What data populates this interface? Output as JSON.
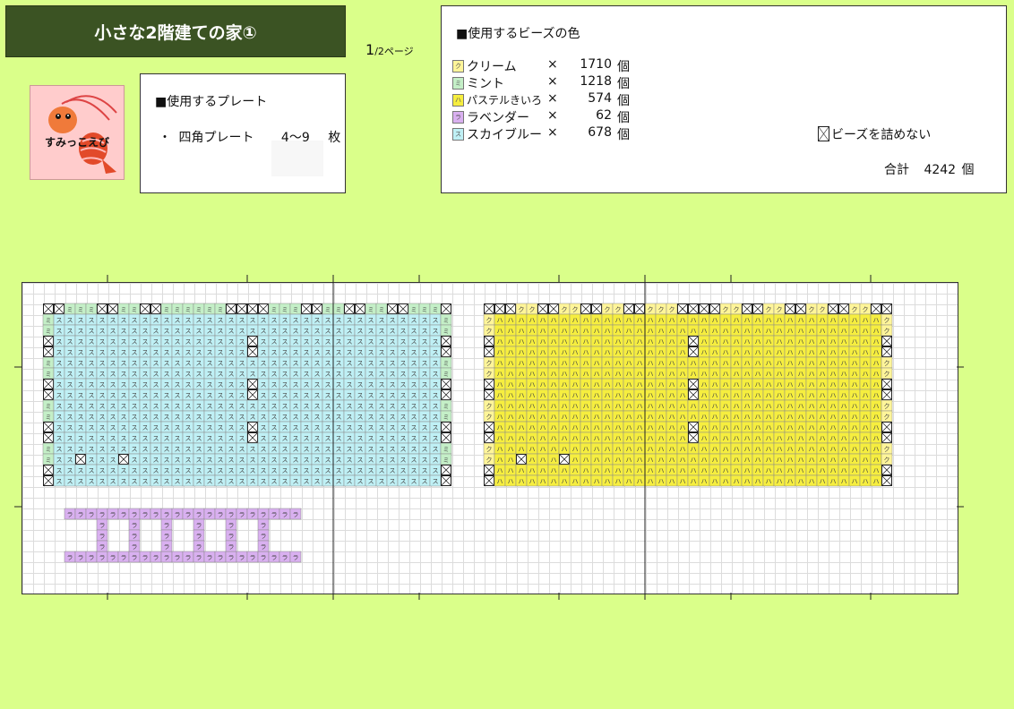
{
  "header": {
    "title": "小さな2階建ての家①",
    "page_current": "1",
    "page_suffix": "/2ページ"
  },
  "logo": {
    "text": "すみっこえび",
    "icon": "shrimp-icon"
  },
  "plate": {
    "heading": "■使用するプレート",
    "bullet": "・",
    "name": "四角プレート",
    "range": "4～9",
    "unit": "枚"
  },
  "beads": {
    "heading": "■使用するビーズの色",
    "items": [
      {
        "symbol": "ク",
        "name": "クリーム",
        "x": "×",
        "count": "1710",
        "unit": "個",
        "color": "#fff599"
      },
      {
        "symbol": "ミ",
        "name": "ミント",
        "x": "×",
        "count": "1218",
        "unit": "個",
        "color": "#c4efc7"
      },
      {
        "symbol": "ハ",
        "name": "パステルきいろ",
        "x": "×",
        "count": "574",
        "unit": "個",
        "color": "#f6ee3f"
      },
      {
        "symbol": "ラ",
        "name": "ラベンダー",
        "x": "×",
        "count": "62",
        "unit": "個",
        "color": "#d9b0f0"
      },
      {
        "symbol": "ス",
        "name": "スカイブルー",
        "x": "×",
        "count": "678",
        "unit": "個",
        "color": "#bff0f5"
      }
    ],
    "no_bead_label": "ビーズを詰めない",
    "total_label": "合計",
    "total_count": "4242",
    "total_unit": "個"
  },
  "pattern": {
    "cell_colors": {
      "mint": "#c4efc7",
      "sky": "#bff0f5",
      "cream": "#fff599",
      "yellow": "#f6ee3f",
      "lavender": "#d9b0f0"
    }
  }
}
